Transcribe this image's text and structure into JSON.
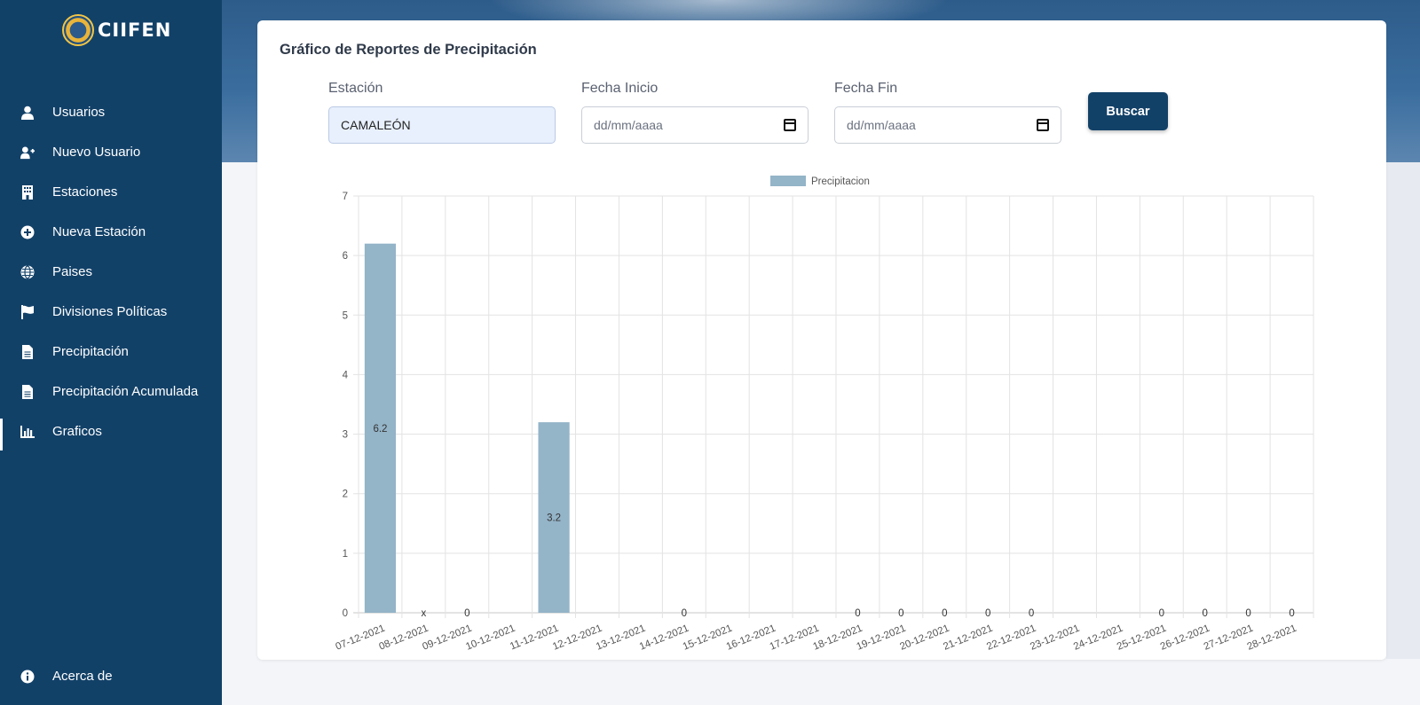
{
  "brand": {
    "name": "CIIFEN"
  },
  "sidebar": {
    "items": [
      {
        "label": "Usuarios",
        "icon": "user-icon"
      },
      {
        "label": "Nuevo Usuario",
        "icon": "user-plus-icon"
      },
      {
        "label": "Estaciones",
        "icon": "building-icon"
      },
      {
        "label": "Nueva Estación",
        "icon": "plus-circle-icon"
      },
      {
        "label": "Paises",
        "icon": "globe-icon"
      },
      {
        "label": "Divisiones Políticas",
        "icon": "flag-icon"
      },
      {
        "label": "Precipitación",
        "icon": "file-icon"
      },
      {
        "label": "Precipitación Acumulada",
        "icon": "file-icon"
      },
      {
        "label": "Graficos",
        "icon": "chart-icon",
        "active": true
      }
    ],
    "bottom": {
      "label": "Acerca de",
      "icon": "info-icon"
    }
  },
  "card": {
    "title": "Gráfico de Reportes de Precipitación",
    "filters": {
      "station": {
        "label": "Estación",
        "value": "CAMALEÓN"
      },
      "start": {
        "label": "Fecha Inicio",
        "placeholder": "dd/mm/aaaa"
      },
      "end": {
        "label": "Fecha Fin",
        "placeholder": "dd/mm/aaaa"
      },
      "search_label": "Buscar"
    }
  },
  "colors": {
    "sidebar": "#124168",
    "bar": "#94b4c8",
    "button": "#124168"
  },
  "chart_data": {
    "type": "bar",
    "legend": "Precipitacion",
    "legend_position": "top",
    "grid": true,
    "ylim": [
      0,
      7
    ],
    "yticks": [
      0,
      1,
      2,
      3,
      4,
      5,
      6,
      7
    ],
    "categories": [
      "07-12-2021",
      "08-12-2021",
      "09-12-2021",
      "10-12-2021",
      "11-12-2021",
      "12-12-2021",
      "13-12-2021",
      "14-12-2021",
      "15-12-2021",
      "16-12-2021",
      "17-12-2021",
      "18-12-2021",
      "19-12-2021",
      "20-12-2021",
      "21-12-2021",
      "22-12-2021",
      "23-12-2021",
      "24-12-2021",
      "25-12-2021",
      "26-12-2021",
      "27-12-2021",
      "28-12-2021"
    ],
    "values": [
      6.2,
      null,
      0,
      null,
      3.2,
      null,
      null,
      0,
      null,
      null,
      null,
      0,
      0,
      0,
      0,
      0,
      null,
      null,
      0,
      0,
      0,
      0
    ],
    "data_labels": [
      "6.2",
      "x",
      "0",
      "",
      "3.2",
      "",
      "",
      "0",
      "",
      "",
      "",
      "0",
      "0",
      "0",
      "0",
      "0",
      "",
      "",
      "0",
      "0",
      "0",
      "0"
    ]
  }
}
